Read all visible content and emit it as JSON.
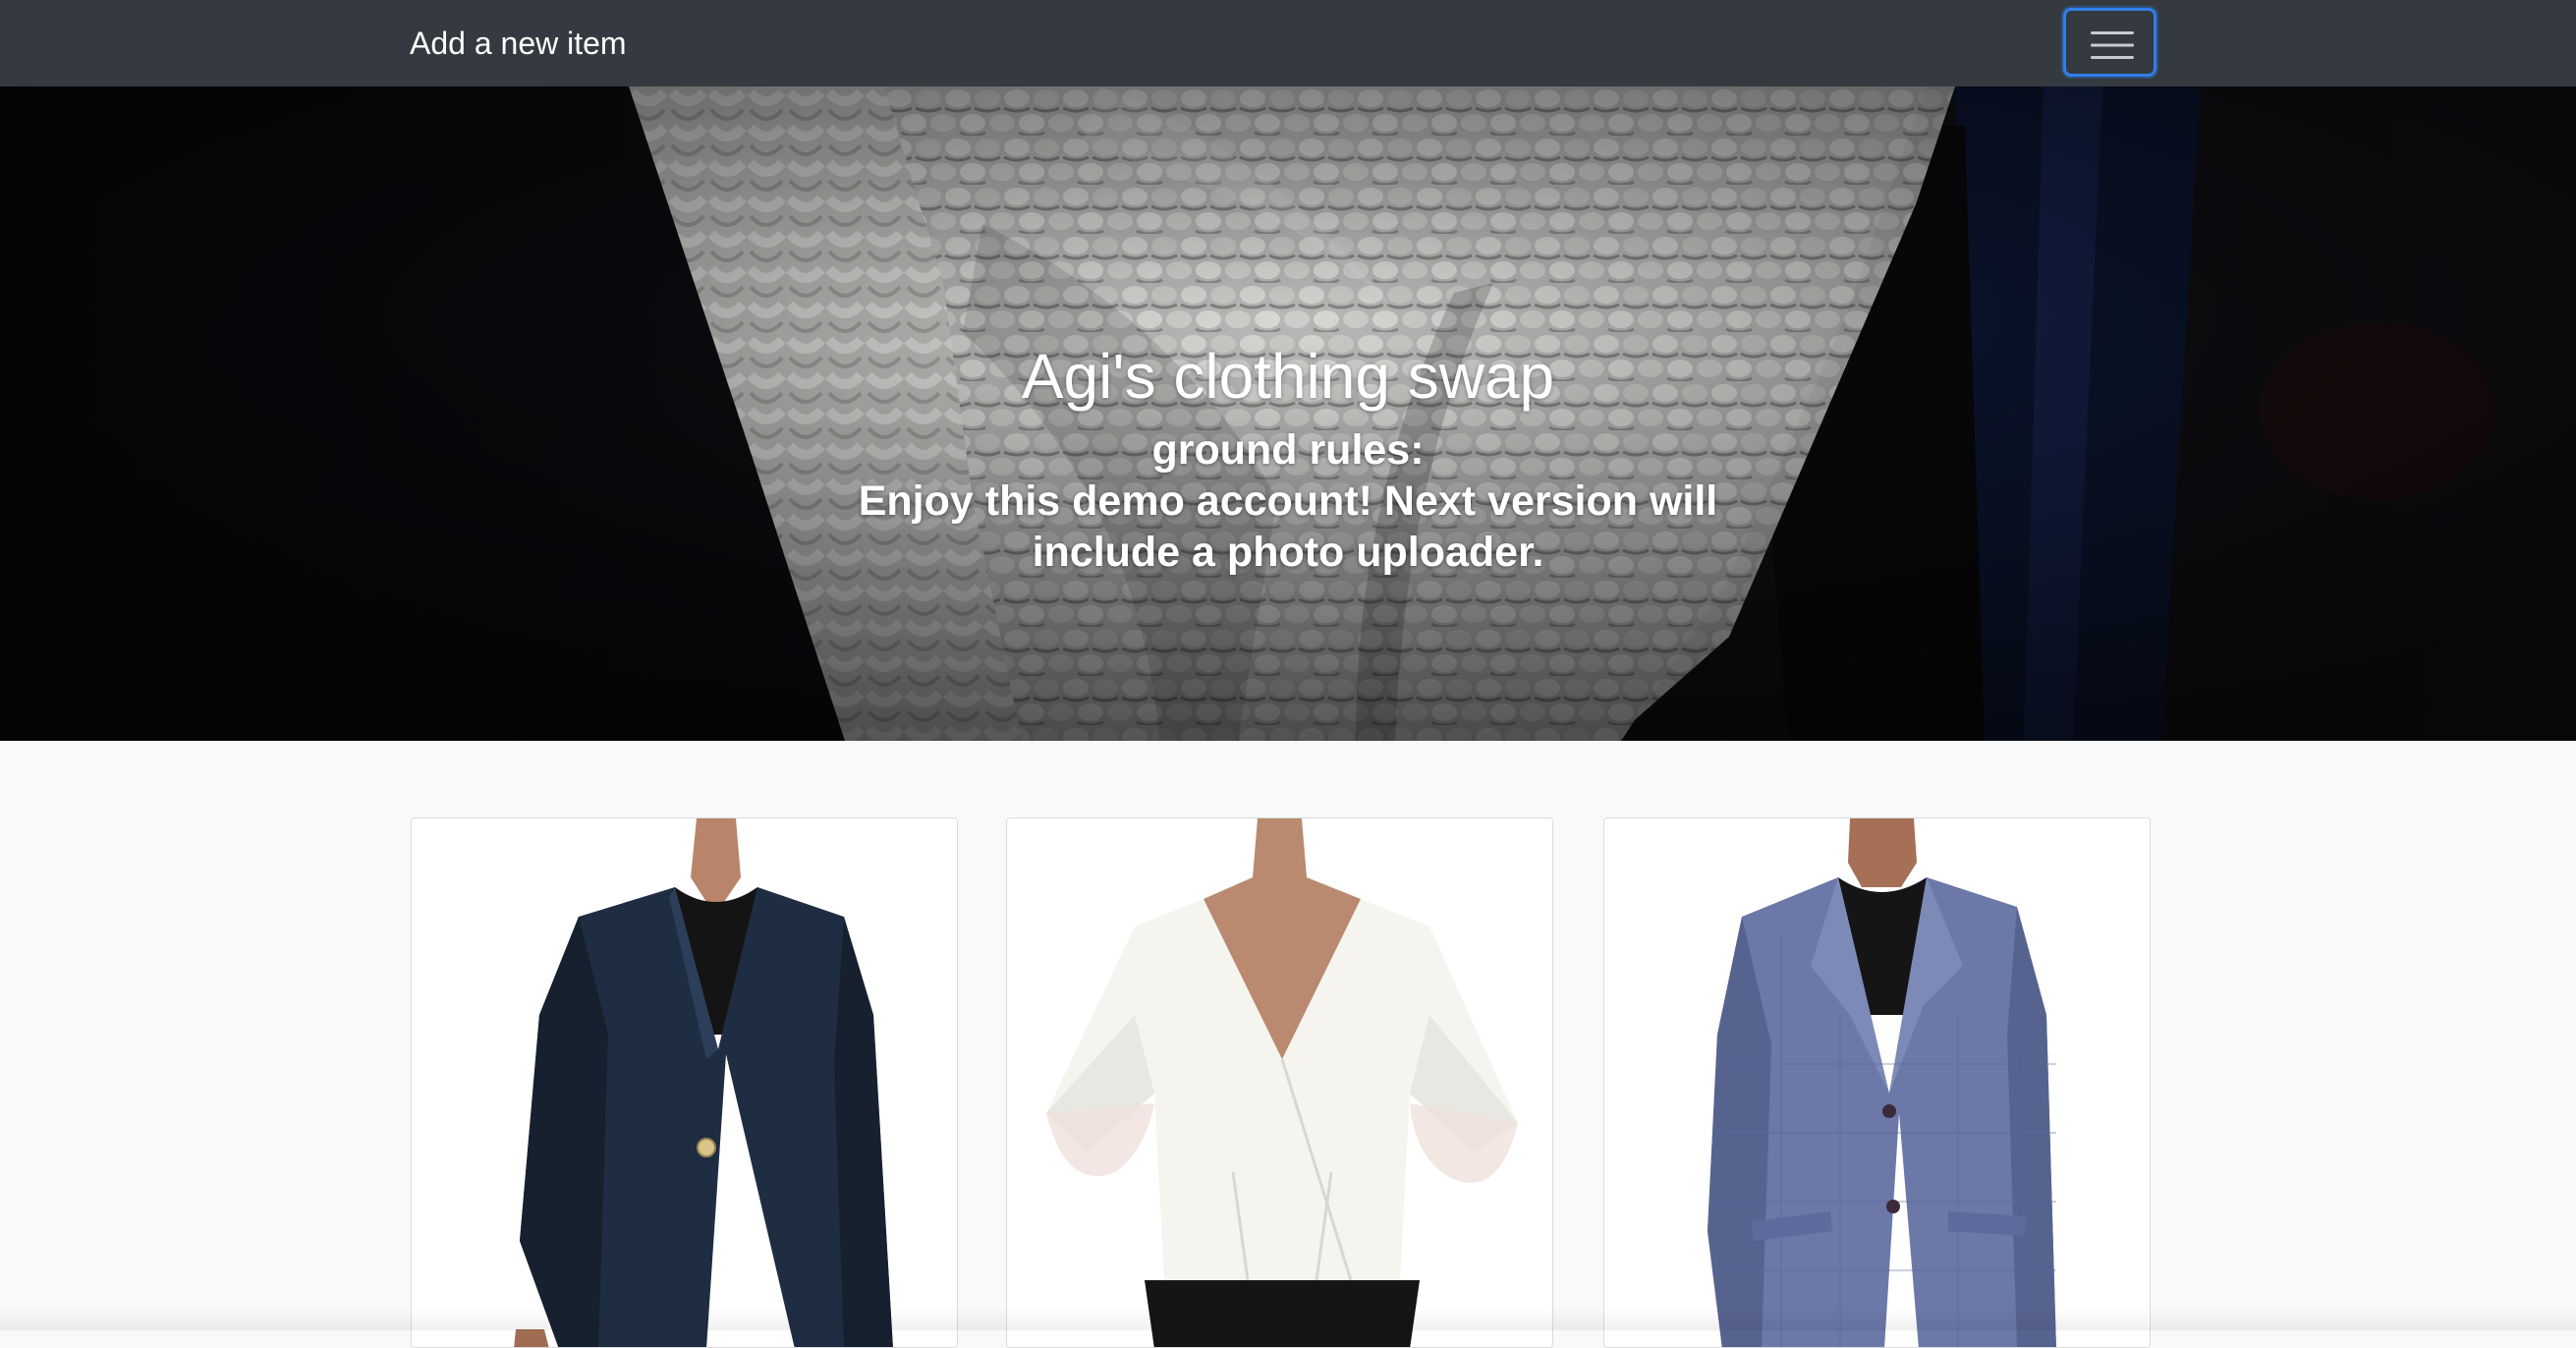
{
  "navbar": {
    "brand": "Add a new item",
    "toggler_icon": "hamburger-icon"
  },
  "hero": {
    "title": "Agi's clothing swap",
    "rules_heading": "ground rules:",
    "rules_text": "Enjoy this demo account! Next version will include a photo uploader.",
    "background": "knit-sweater-photo"
  },
  "items": [
    {
      "image": "navy-velvet-blazer-photo"
    },
    {
      "image": "white-wrap-blouse-photo"
    },
    {
      "image": "blue-plaid-blazer-photo"
    }
  ],
  "colors": {
    "navbar": "#343a40",
    "page": "#f8f9fa",
    "toggler_focus": "#2f7fe8"
  }
}
